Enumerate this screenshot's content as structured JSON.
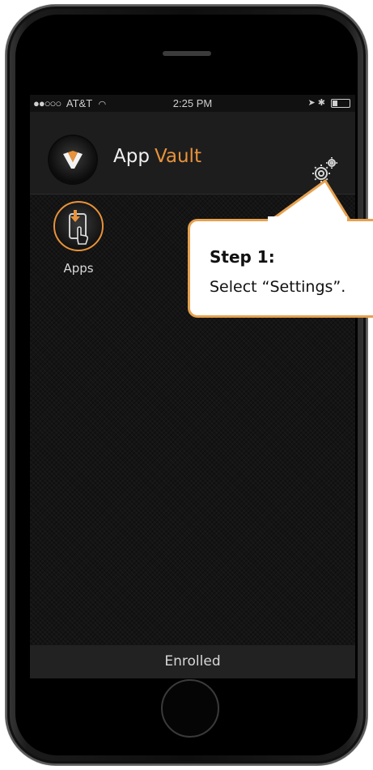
{
  "status_bar": {
    "signal": "●●○○○",
    "carrier": "AT&T",
    "time": "2:25 PM"
  },
  "header": {
    "title_main": "App",
    "title_accent": "Vault",
    "settings_icon": "gear-icon"
  },
  "apps": [
    {
      "label": "Apps",
      "icon": "app-download-touch-icon"
    }
  ],
  "footer": {
    "status": "Enrolled"
  },
  "callout": {
    "title": "Step 1:",
    "text": "Select “Settings”."
  },
  "colors": {
    "accent": "#e8923a",
    "callout_border": "#e6a14f",
    "header_bg": "#1d1d1d",
    "footer_bg": "#222222"
  }
}
